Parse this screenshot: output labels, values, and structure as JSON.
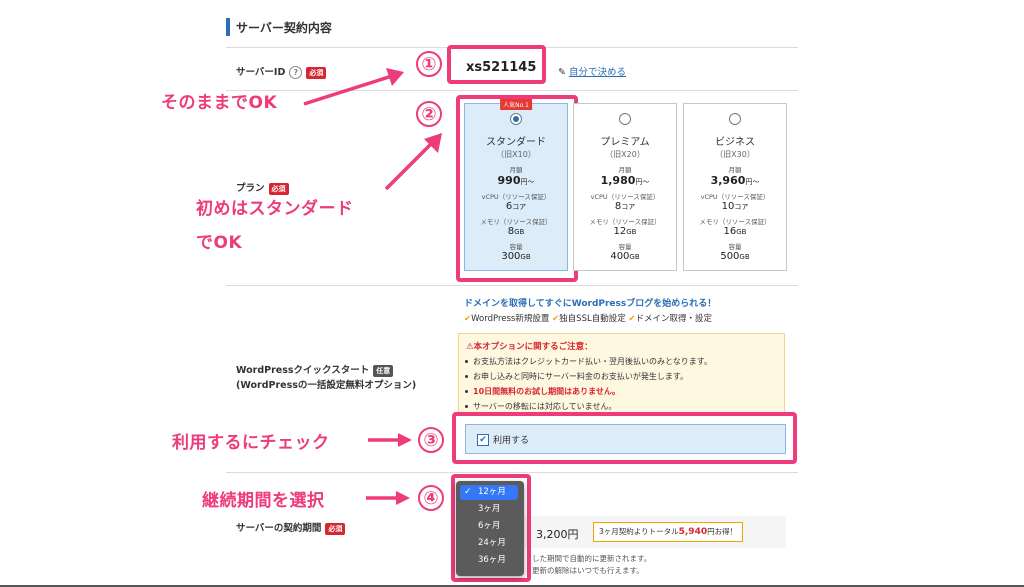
{
  "section": {
    "title": "サーバー契約内容"
  },
  "server_id": {
    "label": "サーバーID",
    "required": "必須",
    "value": "xs521145",
    "self_link": "自分で決める"
  },
  "plan": {
    "label": "プラン",
    "required": "必須",
    "popular_badge": "人気No.1",
    "monthly_label": "月額",
    "cpu_label": "vCPU（リソース保証）",
    "mem_label": "メモリ（リソース保証）",
    "storage_label": "容量",
    "cards": [
      {
        "name": "スタンダード",
        "old": "（旧X10）",
        "price": "990",
        "price_suffix": "円〜",
        "cpu": "6",
        "cpu_unit": "コア",
        "mem": "8",
        "mem_unit": "GB",
        "storage": "300",
        "storage_unit": "GB",
        "selected": true
      },
      {
        "name": "プレミアム",
        "old": "（旧X20）",
        "price": "1,980",
        "price_suffix": "円〜",
        "cpu": "8",
        "cpu_unit": "コア",
        "mem": "12",
        "mem_unit": "GB",
        "storage": "400",
        "storage_unit": "GB",
        "selected": false
      },
      {
        "name": "ビジネス",
        "old": "（旧X30）",
        "price": "3,960",
        "price_suffix": "円〜",
        "cpu": "10",
        "cpu_unit": "コア",
        "mem": "16",
        "mem_unit": "GB",
        "storage": "500",
        "storage_unit": "GB",
        "selected": false
      }
    ]
  },
  "wp_quick": {
    "label_line1": "WordPressクイックスタート",
    "optional": "任意",
    "label_line2": "(WordPressの一括設定無料オプション)",
    "headline": "ドメインを取得してすぐにWordPressブログを始められる！",
    "features": [
      "WordPress新規設置",
      "独自SSL自動設定",
      "ドメイン取得・設定"
    ],
    "notice_title": "本オプションに関するご注意：",
    "notices": [
      "お支払方法はクレジットカード払い・翌月後払いのみとなります。",
      "お申し込みと同時にサーバー料金のお支払いが発生します。",
      "10日間無料のお試し期間はありません。",
      "サーバーの移転には対応していません。"
    ],
    "checkbox_label": "利用する",
    "checked": true
  },
  "contract": {
    "label": "サーバーの契約期間",
    "required": "必須",
    "options": [
      "12ヶ月",
      "3ヶ月",
      "6ヶ月",
      "24ヶ月",
      "36ヶ月"
    ],
    "selected": "12ヶ月",
    "price_fragment": "3,200円",
    "promo_prefix": "3ヶ月契約よりトータル",
    "promo_amount": "5,940",
    "promo_suffix": "円お得！",
    "footnote1": "した期間で自動的に更新されます。",
    "footnote2": "更新の解除はいつでも行えます。"
  },
  "annotations": {
    "n1": "①",
    "n2": "②",
    "n3": "③",
    "n4": "④",
    "t1": "そのままでOK",
    "t2a": "初めはスタンダード",
    "t2b": "でOK",
    "t3": "利用するにチェック",
    "t4": "継続期間を選択"
  },
  "colors": {
    "accent_pink": "#ee3b7b",
    "brand_blue": "#2a6fb5",
    "required_red": "#d6262f"
  }
}
